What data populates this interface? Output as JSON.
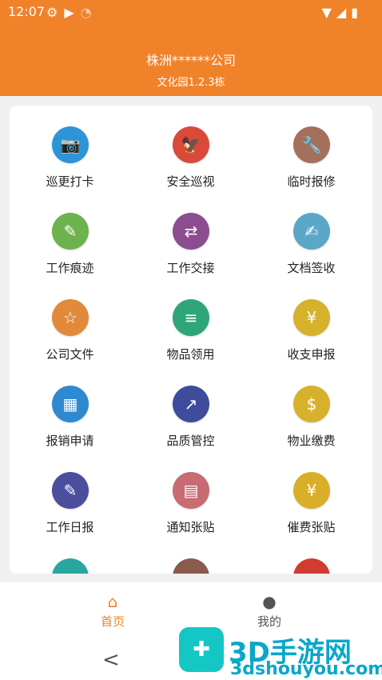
{
  "status_bar": {
    "time": "12:07",
    "icons": [
      "gear-icon",
      "play-shield-icon",
      "wifi-off-icon"
    ],
    "system_icons": [
      "wifi-icon",
      "signal-icon",
      "battery-icon"
    ]
  },
  "header": {
    "title": "株洲******公司",
    "subtitle": "文化园1.2.3栋",
    "color": "#f0822a"
  },
  "grid": [
    {
      "label": "巡更打卡",
      "icon": "camera-icon",
      "color": "#2e94d8"
    },
    {
      "label": "安全巡视",
      "icon": "eagle-icon",
      "color": "#d94a3b"
    },
    {
      "label": "临时报修",
      "icon": "wrench-phone-icon",
      "color": "#a5705b"
    },
    {
      "label": "工作痕迹",
      "icon": "notebook-pen-icon",
      "color": "#6db34d"
    },
    {
      "label": "工作交接",
      "icon": "swap-icon",
      "color": "#8b4d8f"
    },
    {
      "label": "文档签收",
      "icon": "document-sign-icon",
      "color": "#5aa7c8"
    },
    {
      "label": "公司文件",
      "icon": "folder-star-icon",
      "color": "#e08a3a"
    },
    {
      "label": "物品领用",
      "icon": "hand-stack-icon",
      "color": "#2fa57a"
    },
    {
      "label": "收支申报",
      "icon": "yuan-arrows-icon",
      "color": "#d6b12b"
    },
    {
      "label": "报销申请",
      "icon": "calculator-icon",
      "color": "#2f89d0"
    },
    {
      "label": "品质管控",
      "icon": "growth-chart-icon",
      "color": "#3e4c9b"
    },
    {
      "label": "物业缴费",
      "icon": "money-bag-icon",
      "color": "#d8b12c"
    },
    {
      "label": "工作日报",
      "icon": "daily-report-icon",
      "color": "#4b4e9c"
    },
    {
      "label": "通知张贴",
      "icon": "notice-board-icon",
      "color": "#c86b73"
    },
    {
      "label": "催费张贴",
      "icon": "fee-notice-icon",
      "color": "#d9ae2a"
    }
  ],
  "tabs": [
    {
      "label": "首页",
      "icon": "home-icon",
      "active": true,
      "color": "#f0822a"
    },
    {
      "label": "我的",
      "icon": "person-icon",
      "active": false,
      "color": "#555555"
    }
  ],
  "nav": {
    "back": "<"
  },
  "watermark": {
    "text": "3D手游网",
    "sub": "3dshouyou.com"
  }
}
